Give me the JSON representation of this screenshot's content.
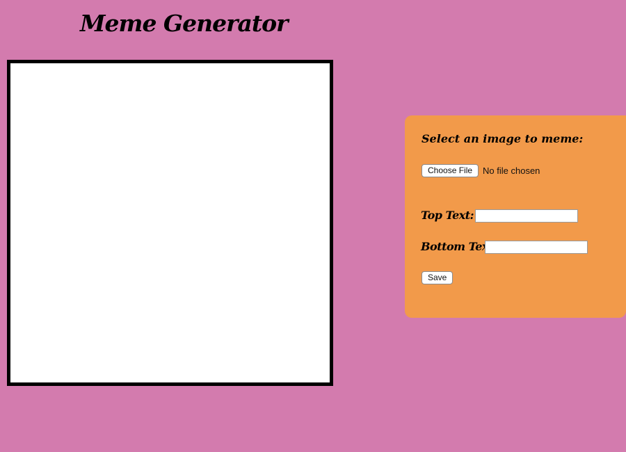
{
  "header": {
    "title": "Meme Generator"
  },
  "form": {
    "heading": "Select an image to meme:",
    "file_button_label": "Choose File",
    "file_status": "No file chosen",
    "top_text_label": "Top Text:",
    "top_text_value": "",
    "bottom_text_label": "Bottom Text:",
    "bottom_text_value": "",
    "save_label": "Save"
  },
  "colors": {
    "background": "#d37bae",
    "panel": "#f29a4a",
    "canvas": "#ffffff",
    "canvas_border": "#000000"
  }
}
